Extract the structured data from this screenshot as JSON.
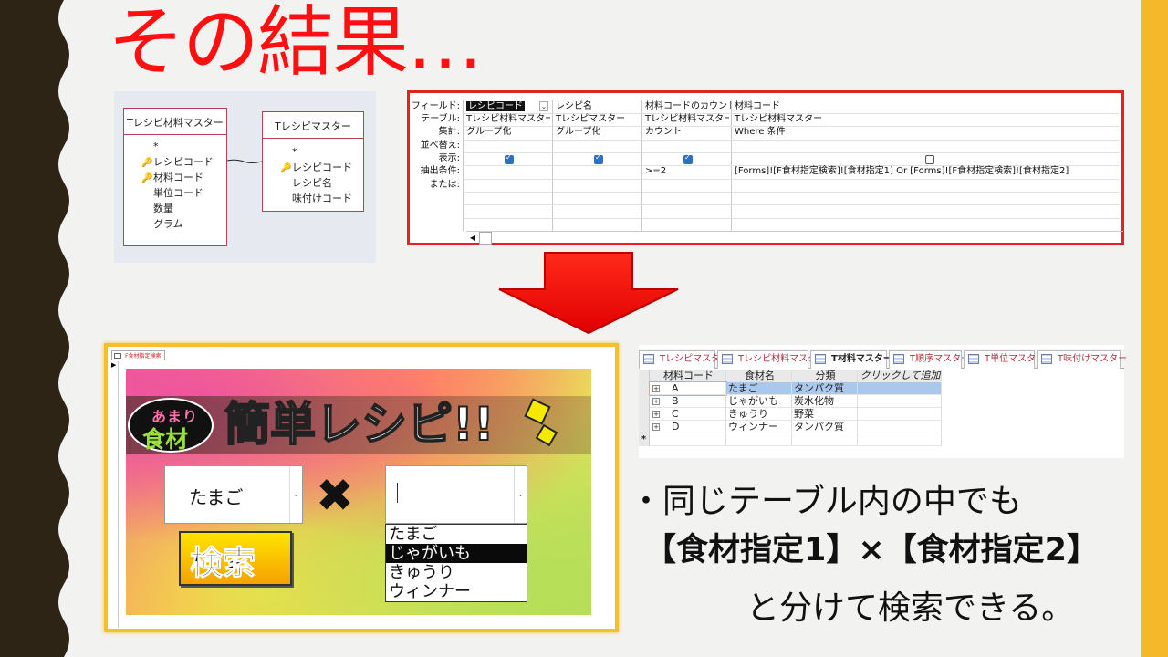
{
  "title": "その結果…",
  "relationships": {
    "table_left": {
      "name": "Tレシピ材料マスター",
      "fields": [
        "*",
        "レシピコード",
        "材料コード",
        "単位コード",
        "数量",
        "グラム"
      ],
      "keys": [
        1,
        2
      ]
    },
    "table_right": {
      "name": "Tレシピマスター",
      "fields": [
        "*",
        "レシピコード",
        "レシピ名",
        "味付けコード"
      ],
      "keys": [
        1
      ]
    }
  },
  "query_grid": {
    "row_labels": [
      "フィールド:",
      "テーブル:",
      "集計:",
      "並べ替え:",
      "表示:",
      "抽出条件:",
      "または:"
    ],
    "columns": [
      {
        "field": "レシピコード",
        "table": "Tレシピ材料マスター",
        "total": "グループ化",
        "show": true,
        "criteria": ""
      },
      {
        "field": "レシピ名",
        "table": "Tレシピマスター",
        "total": "グループ化",
        "show": true,
        "criteria": ""
      },
      {
        "field": "材料コードのカウント: 材料コード",
        "table": "Tレシピ材料マスター",
        "total": "カウント",
        "show": true,
        "criteria": ">=2"
      },
      {
        "field": "材料コード",
        "table": "Tレシピ材料マスター",
        "total": "Where 条件",
        "show": false,
        "criteria": "[Forms]![F食材指定検索]![食材指定1] Or [Forms]![F食材指定検索]![食材指定2]"
      }
    ]
  },
  "form": {
    "tab_label": "F食材指定検索",
    "bubble_small": "あまり",
    "bubble_big": "食材",
    "heading": "簡単レシピ!!",
    "combo1_value": "たまご",
    "times_symbol": "✖",
    "dropdown_items": [
      "たまご",
      "じゃがいも",
      "きゅうり",
      "ウィンナー"
    ],
    "dropdown_selected_index": 1,
    "search_label": "検索"
  },
  "datasheet": {
    "tabs": [
      "Tレシピマスター",
      "Tレシピ材料マスター",
      "T材料マスター",
      "T順序マスター",
      "T単位マスター",
      "T味付けマスター"
    ],
    "active_tab_index": 2,
    "headers": [
      "材料コード",
      "食材名",
      "分類",
      "クリックして追加"
    ],
    "rows": [
      [
        "A",
        "たまご",
        "タンパク質"
      ],
      [
        "B",
        "じゃがいも",
        "炭水化物"
      ],
      [
        "C",
        "きゅうり",
        "野菜"
      ],
      [
        "D",
        "ウィンナー",
        "タンパク質"
      ]
    ],
    "new_row_marker": "*"
  },
  "bullets": {
    "line1": "・同じテーブル内の中でも",
    "line2": "【食材指定1】×【食材指定2】",
    "line3": "と分けて検索できる。"
  },
  "colors": {
    "title": "#ff1010",
    "accent_band": "#f5b82a",
    "dark_band": "#2e2416",
    "highlight_border": "#e02323"
  }
}
